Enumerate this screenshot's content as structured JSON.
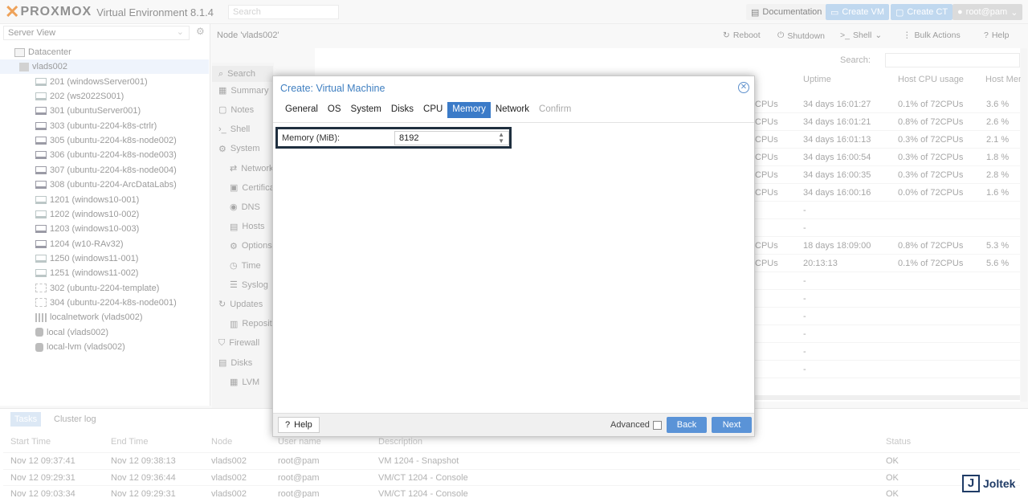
{
  "app": {
    "brand": "PROXMOX",
    "subtitle": "Virtual Environment 8.1.4",
    "search_placeholder": "Search"
  },
  "top_buttons": {
    "documentation": "Documentation",
    "create_vm": "Create VM",
    "create_ct": "Create CT",
    "user": "root@pam"
  },
  "left": {
    "view": "Server View",
    "tree": [
      {
        "label": "Datacenter",
        "icon": "datacenter-icon"
      },
      {
        "label": "vlads002",
        "icon": "server-icon"
      },
      {
        "label": "201 (windowsServer001)",
        "icon": "vm-icon"
      },
      {
        "label": "202 (ws2022S001)",
        "icon": "vm-icon"
      },
      {
        "label": "301 (ubuntuServer001)",
        "icon": "vm-running-icon"
      },
      {
        "label": "303 (ubuntu-2204-k8s-ctrlr)",
        "icon": "vm-running-icon"
      },
      {
        "label": "305 (ubuntu-2204-k8s-node002)",
        "icon": "vm-running-icon"
      },
      {
        "label": "306 (ubuntu-2204-k8s-node003)",
        "icon": "vm-running-icon"
      },
      {
        "label": "307 (ubuntu-2204-k8s-node004)",
        "icon": "vm-running-icon"
      },
      {
        "label": "308 (ubuntu-2204-ArcDataLabs)",
        "icon": "vm-running-icon"
      },
      {
        "label": "1201 (windows10-001)",
        "icon": "vm-icon"
      },
      {
        "label": "1202 (windows10-002)",
        "icon": "vm-icon"
      },
      {
        "label": "1203 (windows10-003)",
        "icon": "vm-running-icon"
      },
      {
        "label": "1204 (w10-RAv32)",
        "icon": "vm-running-icon"
      },
      {
        "label": "1250 (windows11-001)",
        "icon": "vm-icon"
      },
      {
        "label": "1251 (windows11-002)",
        "icon": "vm-icon"
      },
      {
        "label": "302 (ubuntu-2204-template)",
        "icon": "template-icon"
      },
      {
        "label": "304 (ubuntu-2204-k8s-node001)",
        "icon": "template-icon"
      },
      {
        "label": "localnetwork (vlads002)",
        "icon": "network-icon"
      },
      {
        "label": "local (vlads002)",
        "icon": "storage-icon"
      },
      {
        "label": "local-lvm (vlads002)",
        "icon": "storage-icon"
      }
    ]
  },
  "node": {
    "title": "Node 'vlads002'",
    "actions": {
      "reboot": "Reboot",
      "shutdown": "Shutdown",
      "shell": "Shell",
      "bulk": "Bulk Actions",
      "help": "Help"
    }
  },
  "nav": [
    {
      "label": "Search"
    },
    {
      "label": "Summary"
    },
    {
      "label": "Notes"
    },
    {
      "label": "Shell"
    },
    {
      "label": "System"
    },
    {
      "label": "Network"
    },
    {
      "label": "Certificates"
    },
    {
      "label": "DNS"
    },
    {
      "label": "Hosts"
    },
    {
      "label": "Options"
    },
    {
      "label": "Time"
    },
    {
      "label": "Syslog"
    },
    {
      "label": "Updates"
    },
    {
      "label": "Repositories"
    },
    {
      "label": "Firewall"
    },
    {
      "label": "Disks"
    },
    {
      "label": "LVM"
    }
  ],
  "grid": {
    "search_label": "Search:",
    "headers": {
      "uptime": "Uptime",
      "cpu": "Host CPU usage",
      "mem": "Host Mem"
    },
    "rows": [
      {
        "cpus": "CPUs",
        "uptime": "34 days 16:01:27",
        "cpu": "0.1% of 72CPUs",
        "mem": "3.6 %"
      },
      {
        "cpus": "CPUs",
        "uptime": "34 days 16:01:21",
        "cpu": "0.8% of 72CPUs",
        "mem": "2.6 %"
      },
      {
        "cpus": "CPUs",
        "uptime": "34 days 16:01:13",
        "cpu": "0.3% of 72CPUs",
        "mem": "2.1 %"
      },
      {
        "cpus": "CPUs",
        "uptime": "34 days 16:00:54",
        "cpu": "0.3% of 72CPUs",
        "mem": "1.8 %"
      },
      {
        "cpus": "CPUs",
        "uptime": "34 days 16:00:35",
        "cpu": "0.3% of 72CPUs",
        "mem": "2.8 %"
      },
      {
        "cpus": "CPUs",
        "uptime": "34 days 16:00:16",
        "cpu": "0.0% of 72CPUs",
        "mem": "1.6 %"
      },
      {
        "cpus": "",
        "uptime": "-",
        "cpu": "",
        "mem": ""
      },
      {
        "cpus": "",
        "uptime": "-",
        "cpu": "",
        "mem": ""
      },
      {
        "cpus": "CPUs",
        "uptime": "18 days 18:09:00",
        "cpu": "0.8% of 72CPUs",
        "mem": "5.3 %"
      },
      {
        "cpus": "CPUs",
        "uptime": "20:13:13",
        "cpu": "0.1% of 72CPUs",
        "mem": "5.6 %"
      },
      {
        "cpus": "",
        "uptime": "-",
        "cpu": "",
        "mem": ""
      },
      {
        "cpus": "",
        "uptime": "-",
        "cpu": "",
        "mem": ""
      },
      {
        "cpus": "",
        "uptime": "-",
        "cpu": "",
        "mem": ""
      },
      {
        "cpus": "",
        "uptime": "-",
        "cpu": "",
        "mem": ""
      },
      {
        "cpus": "",
        "uptime": "-",
        "cpu": "",
        "mem": ""
      },
      {
        "cpus": "",
        "uptime": "-",
        "cpu": "",
        "mem": ""
      }
    ]
  },
  "dialog": {
    "title": "Create: Virtual Machine",
    "tabs": [
      "General",
      "OS",
      "System",
      "Disks",
      "CPU",
      "Memory",
      "Network",
      "Confirm"
    ],
    "active_tab": "Memory",
    "memory_label": "Memory (MiB):",
    "memory_value": "8192",
    "help": "Help",
    "advanced": "Advanced",
    "back": "Back",
    "next": "Next"
  },
  "bottom": {
    "tabs": [
      "Tasks",
      "Cluster log"
    ],
    "columns": [
      "Start Time",
      "End Time",
      "Node",
      "User name",
      "Description",
      "Status"
    ],
    "rows": [
      [
        "Nov 12 09:37:41",
        "Nov 12 09:38:13",
        "vlads002",
        "root@pam",
        "VM 1204 - Snapshot",
        "OK"
      ],
      [
        "Nov 12 09:29:31",
        "Nov 12 09:36:44",
        "vlads002",
        "root@pam",
        "VM/CT 1204 - Console",
        "OK"
      ],
      [
        "Nov 12 09:03:34",
        "Nov 12 09:29:31",
        "vlads002",
        "root@pam",
        "VM/CT 1204 - Console",
        "OK"
      ]
    ]
  },
  "watermark": "Joltek",
  "colors": {
    "accent": "#3b7bc8",
    "brand_orange": "#e57000",
    "highlight_box": "#1f2f3f"
  }
}
